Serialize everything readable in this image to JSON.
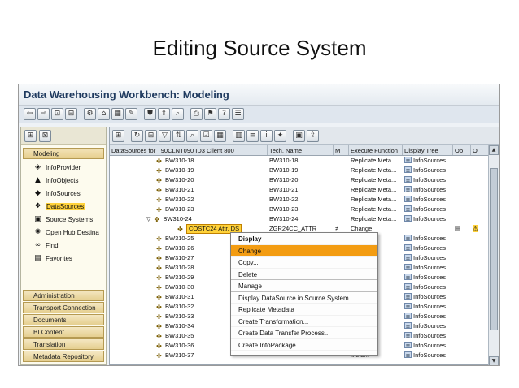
{
  "slide": {
    "title": "Editing Source System"
  },
  "window": {
    "title": "Data Warehousing Workbench: Modeling"
  },
  "toolbar": {
    "icons": [
      "back-arrow-icon",
      "forward-arrow-icon",
      "exit-icon",
      "cancel-icon",
      "object-icon",
      "table-icon",
      "display-icon",
      "change-icon",
      "activate-icon",
      "transport-icon",
      "find-icon",
      "print-icon",
      "bookmark-icon",
      "help-icon",
      "settings-icon"
    ]
  },
  "left": {
    "heading": "Modeling",
    "items": [
      {
        "label": "InfoProvider",
        "icon": "cube-icon",
        "glyph": "◈"
      },
      {
        "label": "InfoObjects",
        "icon": "infoobject-icon",
        "glyph": "▲"
      },
      {
        "label": "InfoSources",
        "icon": "infosource-icon",
        "glyph": "◆"
      },
      {
        "label": "DataSources",
        "icon": "datasource-icon",
        "glyph": "❖"
      },
      {
        "label": "Source Systems",
        "icon": "source-system-icon",
        "glyph": "▣"
      },
      {
        "label": "Open Hub Destina",
        "icon": "open-hub-icon",
        "glyph": "✺"
      },
      {
        "label": "Find",
        "icon": "binoculars-icon",
        "glyph": "∞"
      },
      {
        "label": "Favorites",
        "icon": "favorites-icon",
        "glyph": "▤"
      }
    ],
    "buttons": [
      "Administration",
      "Transport Connection",
      "Documents",
      "BI Content",
      "Translation",
      "Metadata Repository"
    ]
  },
  "table": {
    "headers": [
      "DataSources for T90CLNT090 ID3 Client 800",
      "Tech. Name",
      "M",
      "Execute Function",
      "Display Tree",
      "Ob",
      "O"
    ],
    "rows": [
      {
        "name": "BW310-18",
        "tech": "BW310-18",
        "m": "",
        "exec": "Replicate Meta...",
        "tree": "InfoSources",
        "indent": 2
      },
      {
        "name": "BW310-19",
        "tech": "BW310-19",
        "m": "",
        "exec": "Replicate Meta...",
        "tree": "InfoSources",
        "indent": 2
      },
      {
        "name": "BW310-20",
        "tech": "BW310-20",
        "m": "",
        "exec": "Replicate Meta...",
        "tree": "InfoSources",
        "indent": 2
      },
      {
        "name": "BW310-21",
        "tech": "BW310-21",
        "m": "",
        "exec": "Replicate Meta...",
        "tree": "InfoSources",
        "indent": 2
      },
      {
        "name": "BW310-22",
        "tech": "BW310-22",
        "m": "",
        "exec": "Replicate Meta...",
        "tree": "InfoSources",
        "indent": 2
      },
      {
        "name": "BW310-23",
        "tech": "BW310-23",
        "m": "",
        "exec": "Replicate Meta...",
        "tree": "InfoSources",
        "indent": 2
      },
      {
        "name": "BW310-24",
        "tech": "BW310-24",
        "m": "",
        "exec": "Replicate Meta...",
        "tree": "InfoSources",
        "indent": 2,
        "expanded": true
      },
      {
        "name": "COSTC24 Attr. DS",
        "tech": "ZGR24CC_ATTR",
        "m": "≠",
        "exec": "Change",
        "tree": "",
        "indent": 3,
        "highlight": true
      },
      {
        "name": "BW310-25",
        "tech": "",
        "m": "",
        "exec": "Meta...",
        "tree": "InfoSources",
        "indent": 2
      },
      {
        "name": "BW310-26",
        "tech": "",
        "m": "",
        "exec": "Meta...",
        "tree": "InfoSources",
        "indent": 2
      },
      {
        "name": "BW310-27",
        "tech": "",
        "m": "",
        "exec": "Meta...",
        "tree": "InfoSources",
        "indent": 2
      },
      {
        "name": "BW310-28",
        "tech": "",
        "m": "",
        "exec": "Meta...",
        "tree": "InfoSources",
        "indent": 2
      },
      {
        "name": "BW310-29",
        "tech": "",
        "m": "",
        "exec": "Meta...",
        "tree": "InfoSources",
        "indent": 2
      },
      {
        "name": "BW310-30",
        "tech": "",
        "m": "",
        "exec": "Meta...",
        "tree": "InfoSources",
        "indent": 2
      },
      {
        "name": "BW310-31",
        "tech": "",
        "m": "",
        "exec": "Meta...",
        "tree": "InfoSources",
        "indent": 2
      },
      {
        "name": "BW310-32",
        "tech": "",
        "m": "",
        "exec": "Meta...",
        "tree": "InfoSources",
        "indent": 2
      },
      {
        "name": "BW310-33",
        "tech": "",
        "m": "",
        "exec": "Meta...",
        "tree": "InfoSources",
        "indent": 2
      },
      {
        "name": "BW310-34",
        "tech": "",
        "m": "",
        "exec": "Meta...",
        "tree": "InfoSources",
        "indent": 2
      },
      {
        "name": "BW310-35",
        "tech": "",
        "m": "",
        "exec": "Meta...",
        "tree": "InfoSources",
        "indent": 2
      },
      {
        "name": "BW310-36",
        "tech": "",
        "m": "",
        "exec": "Meta...",
        "tree": "InfoSources",
        "indent": 2
      },
      {
        "name": "BW310-37",
        "tech": "",
        "m": "",
        "exec": "Meta...",
        "tree": "InfoSources",
        "indent": 2
      }
    ]
  },
  "context_menu": {
    "items": [
      {
        "label": "Display",
        "bold": true
      },
      {
        "label": "Change",
        "active": true
      },
      {
        "label": "Copy..."
      },
      {
        "label": "Delete",
        "sep": true
      },
      {
        "label": "Manage",
        "sep": true
      },
      {
        "label": "Display DataSource in Source System"
      },
      {
        "label": "Replicate Metadata"
      },
      {
        "label": "Create Transformation..."
      },
      {
        "label": "Create Data Transfer Process..."
      },
      {
        "label": "Create InfoPackage..."
      }
    ]
  },
  "colors": {
    "highlight": "#ffd23a",
    "menu_active": "#f39c12",
    "title_text": "#1f3a5f"
  }
}
